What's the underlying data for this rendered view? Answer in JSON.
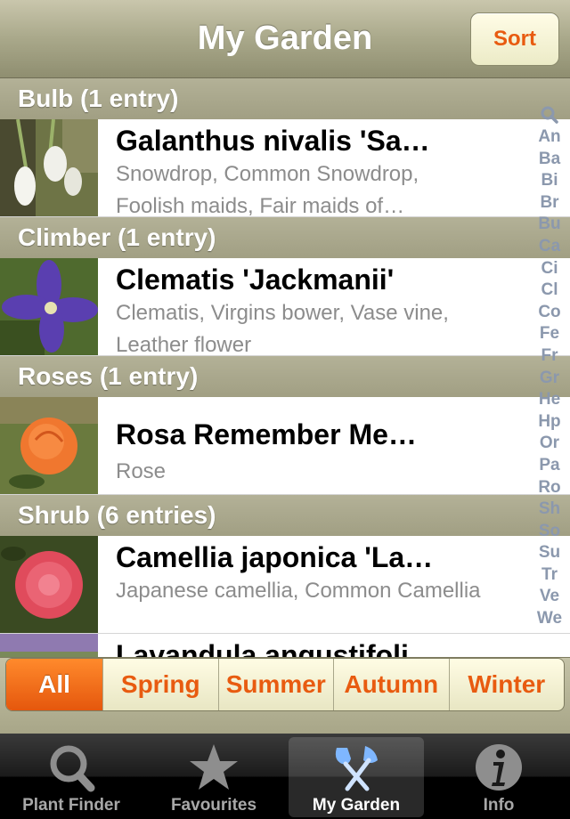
{
  "navbar": {
    "title": "My Garden",
    "sort_label": "Sort"
  },
  "sections": [
    {
      "header": "Bulb (1 entry)",
      "rows": [
        {
          "title": "Galanthus nivalis 'Sa…",
          "subtitle": "Snowdrop, Common Snowdrop, Foolish maids, Fair maids of…"
        }
      ]
    },
    {
      "header": "Climber (1 entry)",
      "rows": [
        {
          "title": "Clematis 'Jackmanii'",
          "subtitle": "Clematis, Virgins bower, Vase vine, Leather flower"
        }
      ]
    },
    {
      "header": "Roses (1 entry)",
      "rows": [
        {
          "title": "Rosa Remember Me…",
          "subtitle": "Rose"
        }
      ]
    },
    {
      "header": "Shrub (6 entries)",
      "rows": [
        {
          "title": "Camellia japonica 'La…",
          "subtitle": "Japanese camellia, Common Camellia"
        },
        {
          "title": "Lavandula angustifoli…",
          "subtitle": ""
        }
      ]
    }
  ],
  "index": [
    "An",
    "Ba",
    "Bi",
    "Br",
    "Bu",
    "Ca",
    "Ci",
    "Cl",
    "Co",
    "Fe",
    "Fr",
    "Gr",
    "He",
    "Hp",
    "Or",
    "Pa",
    "Ro",
    "Sh",
    "So",
    "Su",
    "Tr",
    "Ve",
    "We"
  ],
  "segments": [
    "All",
    "Spring",
    "Summer",
    "Autumn",
    "Winter"
  ],
  "tabs": [
    "Plant Finder",
    "Favourites",
    "My Garden",
    "Info"
  ],
  "colors": {
    "accent": "#e85b10",
    "header": "#a9a78a"
  }
}
